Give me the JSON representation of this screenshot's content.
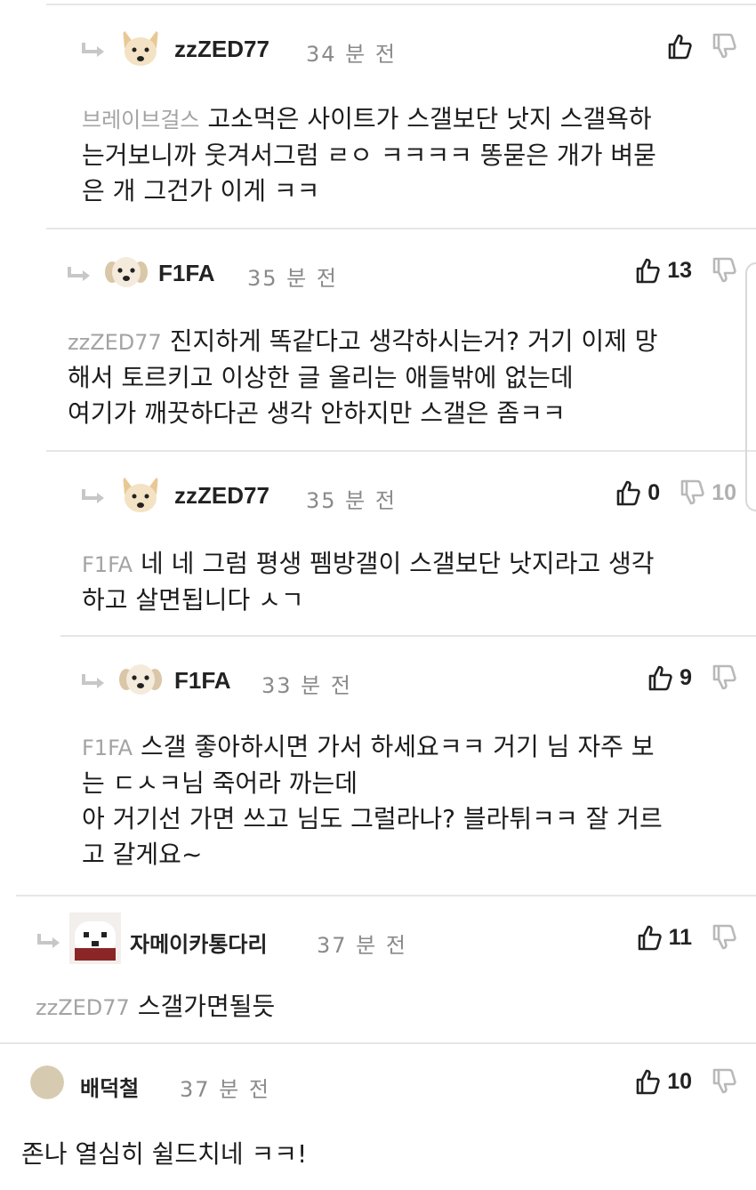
{
  "comments": [
    {
      "username": "zzZED77",
      "time": "34 분 전",
      "upvotes": "",
      "downvotes": "",
      "mention": "브레이브걸스",
      "text": "고소먹은 사이트가 스갤보단 낫지 스갤욕하\n는거보니까 웃겨서그럼 ㄹㅇ ㅋㅋㅋㅋ 똥묻은 개가 벼묻\n은 개 그건가 이게 ㅋㅋ",
      "avatar": "shiba-avatar"
    },
    {
      "username": "F1FA",
      "time": "35 분 전",
      "upvotes": "13",
      "downvotes": "",
      "mention": "zzZED77",
      "text": "진지하게 똑같다고 생각하시는거? 거기 이제 망\n해서 토르키고 이상한 글 올리는 애들밖에 없는데\n여기가 깨끗하다곤 생각 안하지만 스갤은 좀ㅋㅋ",
      "avatar": "puppy-avatar"
    },
    {
      "username": "zzZED77",
      "time": "35 분 전",
      "upvotes": "0",
      "downvotes": "10",
      "mention": "F1FA",
      "text": "네 네 그럼 평생 펨방갤이 스갤보단 낫지라고 생각\n하고 살면됩니다 ㅅㄱ",
      "avatar": "shiba-avatar"
    },
    {
      "username": "F1FA",
      "time": "33 분 전",
      "upvotes": "9",
      "downvotes": "",
      "mention": "F1FA",
      "text": "스갤 좋아하시면 가서 하세요ㅋㅋ 거기 님 자주 보\n는 ㄷㅅㅋ님 죽어라 까는데\n아 거기선 가면 쓰고 님도 그럴라나? 블라튀ㅋㅋ 잘 거르\n고 갈게요~",
      "avatar": "puppy-avatar"
    },
    {
      "username": "자메이카통다리",
      "time": "37 분 전",
      "upvotes": "11",
      "downvotes": "",
      "mention": "zzZED77",
      "text": "스갤가면될듯",
      "avatar": "pixel-avatar"
    },
    {
      "username": "배덕철",
      "time": "37 분 전",
      "upvotes": "10",
      "downvotes": "",
      "mention": "",
      "text": "존나 열심히 쉴드치네 ㅋㅋ!",
      "avatar": "default-avatar"
    }
  ],
  "icons": {
    "upvote": "thumbs-up-icon",
    "downvote": "thumbs-down-icon",
    "reply": "reply-arrow-icon"
  },
  "colors": {
    "mention": "#a3a3a3",
    "time": "#8a8a8a",
    "downvote": "#b0b0b0",
    "divider": "#e6e6e6"
  }
}
